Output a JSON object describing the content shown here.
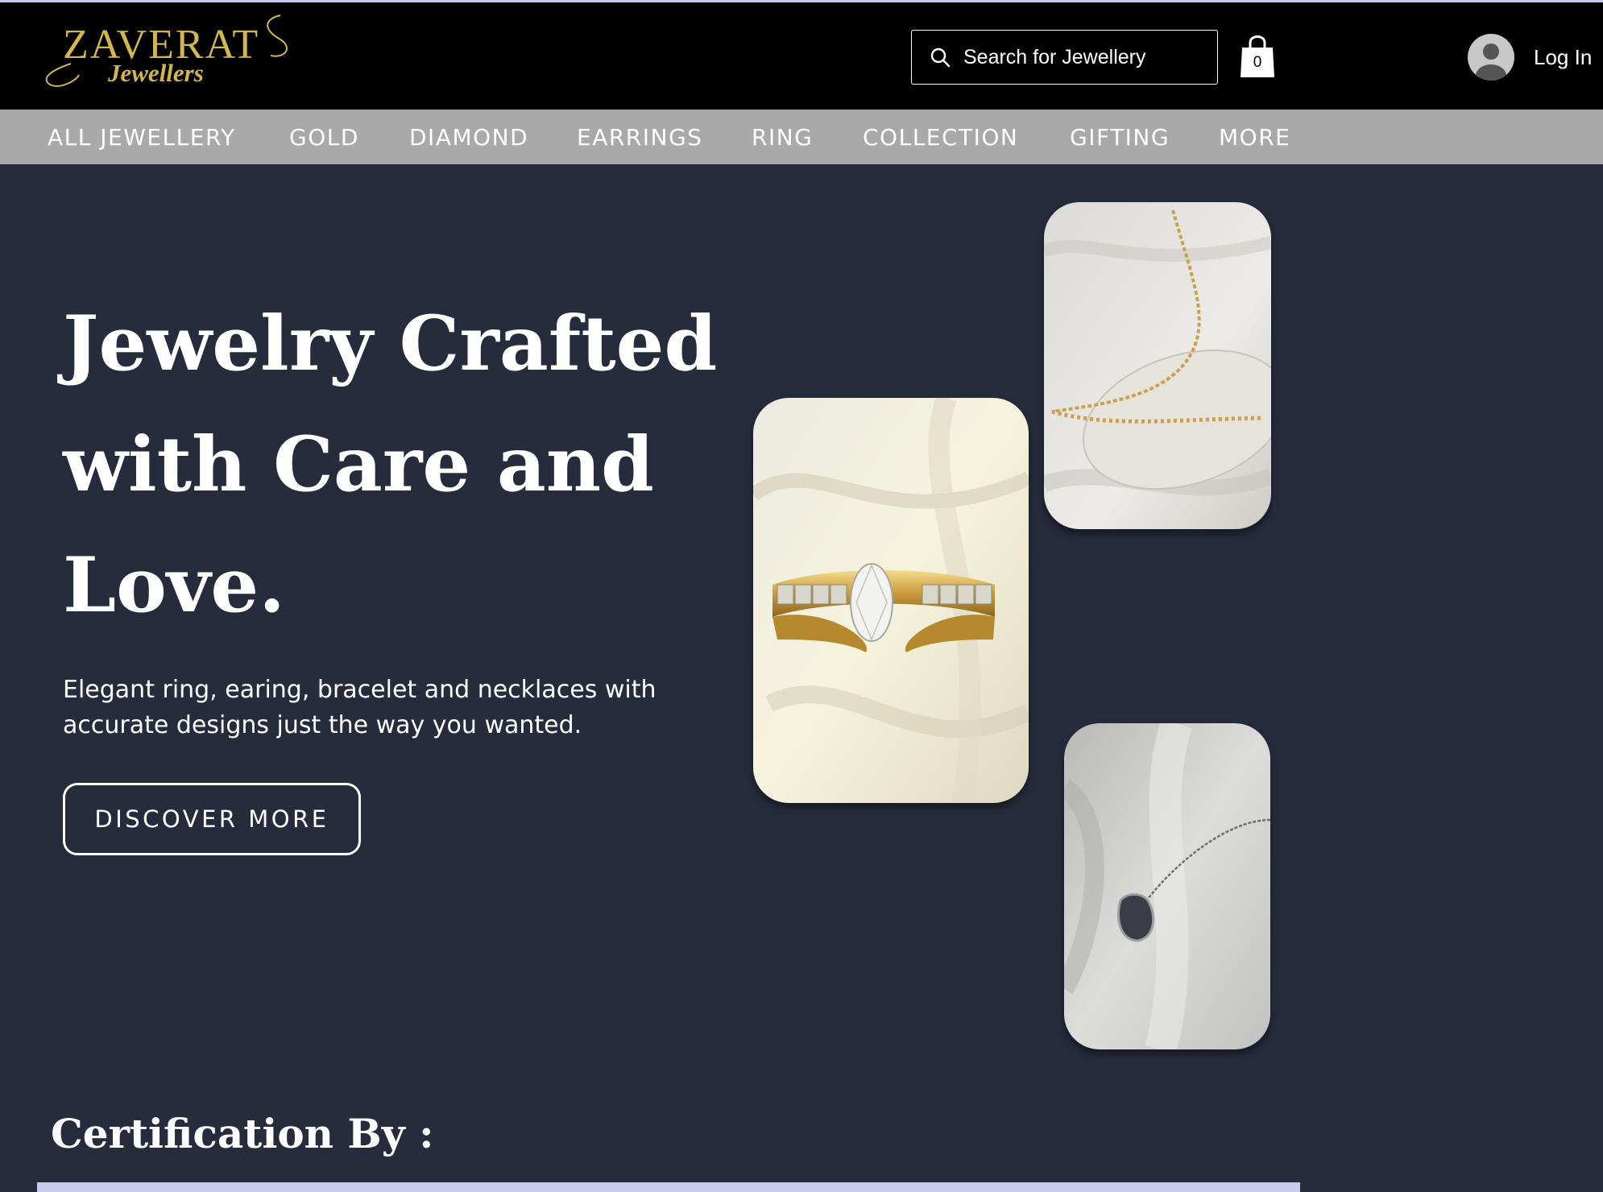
{
  "brand": {
    "name": "ZAVERAT",
    "subtitle": "Jewellers",
    "gold_color": "#d2b64e"
  },
  "header": {
    "search_placeholder": "Search for Jewellery",
    "cart_count": "0",
    "login_label": "Log In"
  },
  "nav": {
    "items": [
      "ALL JEWELLERY",
      "GOLD",
      "DIAMOND",
      "EARRINGS",
      "RING",
      "COLLECTION",
      "GIFTING",
      "MORE"
    ]
  },
  "hero": {
    "title": "Jewelry Crafted with Care and Love.",
    "description": "Elegant ring, earing, bracelet and necklaces with accurate designs just the way you wanted.",
    "button_label": "DISCOVER MORE"
  },
  "certification": {
    "title": "Certification By :"
  },
  "colors": {
    "background": "#272c3d",
    "header": "#000000",
    "nav": "#a9a9a9",
    "accent_bar": "#c8cdeb"
  }
}
